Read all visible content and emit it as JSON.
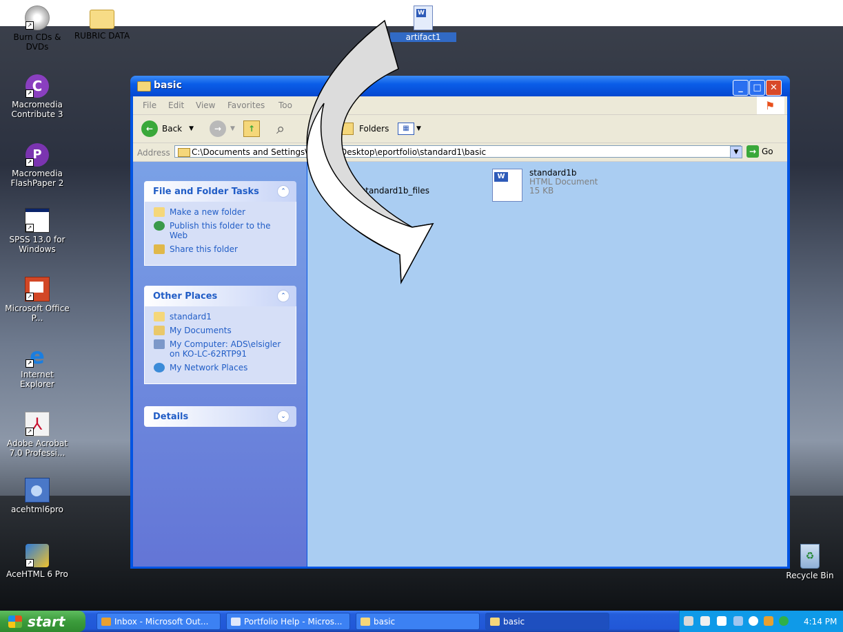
{
  "desktop": {
    "icons": [
      {
        "label": "Burn CDs & DVDs"
      },
      {
        "label": "RUBRIC DATA"
      },
      {
        "label": "artifact1"
      },
      {
        "label": "Macromedia Contribute 3"
      },
      {
        "label": "Macromedia FlashPaper 2"
      },
      {
        "label": "SPSS 13.0 for Windows"
      },
      {
        "label": "Microsoft Office P..."
      },
      {
        "label": "Internet Explorer"
      },
      {
        "label": "Adobe Acrobat 7.0 Professi..."
      },
      {
        "label": "acehtml6pro"
      },
      {
        "label": "AceHTML 6 Pro"
      },
      {
        "label": "Recycle Bin"
      }
    ]
  },
  "window": {
    "title": "basic",
    "menu": [
      "File",
      "Edit",
      "View",
      "Favorites",
      "Too"
    ],
    "toolbar": {
      "back": "Back",
      "search": "rch",
      "folders": "Folders"
    },
    "address": {
      "label": "Address",
      "value": "C:\\Documents and Settings\\elsigler\\Desktop\\eportfolio\\standard1\\basic",
      "go": "Go"
    },
    "file_tasks": {
      "title": "File and Folder Tasks",
      "items": [
        "Make a new folder",
        "Publish this folder to the Web",
        "Share this folder"
      ]
    },
    "other_places": {
      "title": "Other Places",
      "items": [
        "standard1",
        "My Documents",
        "My Computer: ADS\\elsigler on KO-LC-62RTP91",
        "My Network Places"
      ]
    },
    "details": {
      "title": "Details"
    },
    "files": [
      {
        "name": "standard1b_files"
      },
      {
        "name": "standard1b",
        "type": "HTML Document",
        "size": "15 KB"
      }
    ]
  },
  "taskbar": {
    "start": "start",
    "buttons": [
      "Inbox - Microsoft Out...",
      "Portfolio Help - Micros...",
      "basic",
      "basic"
    ],
    "clock": "4:14 PM"
  },
  "colors": {
    "accent": "#316ac5",
    "content_bg": "#aacdf2",
    "taskbar": "#245edb"
  }
}
